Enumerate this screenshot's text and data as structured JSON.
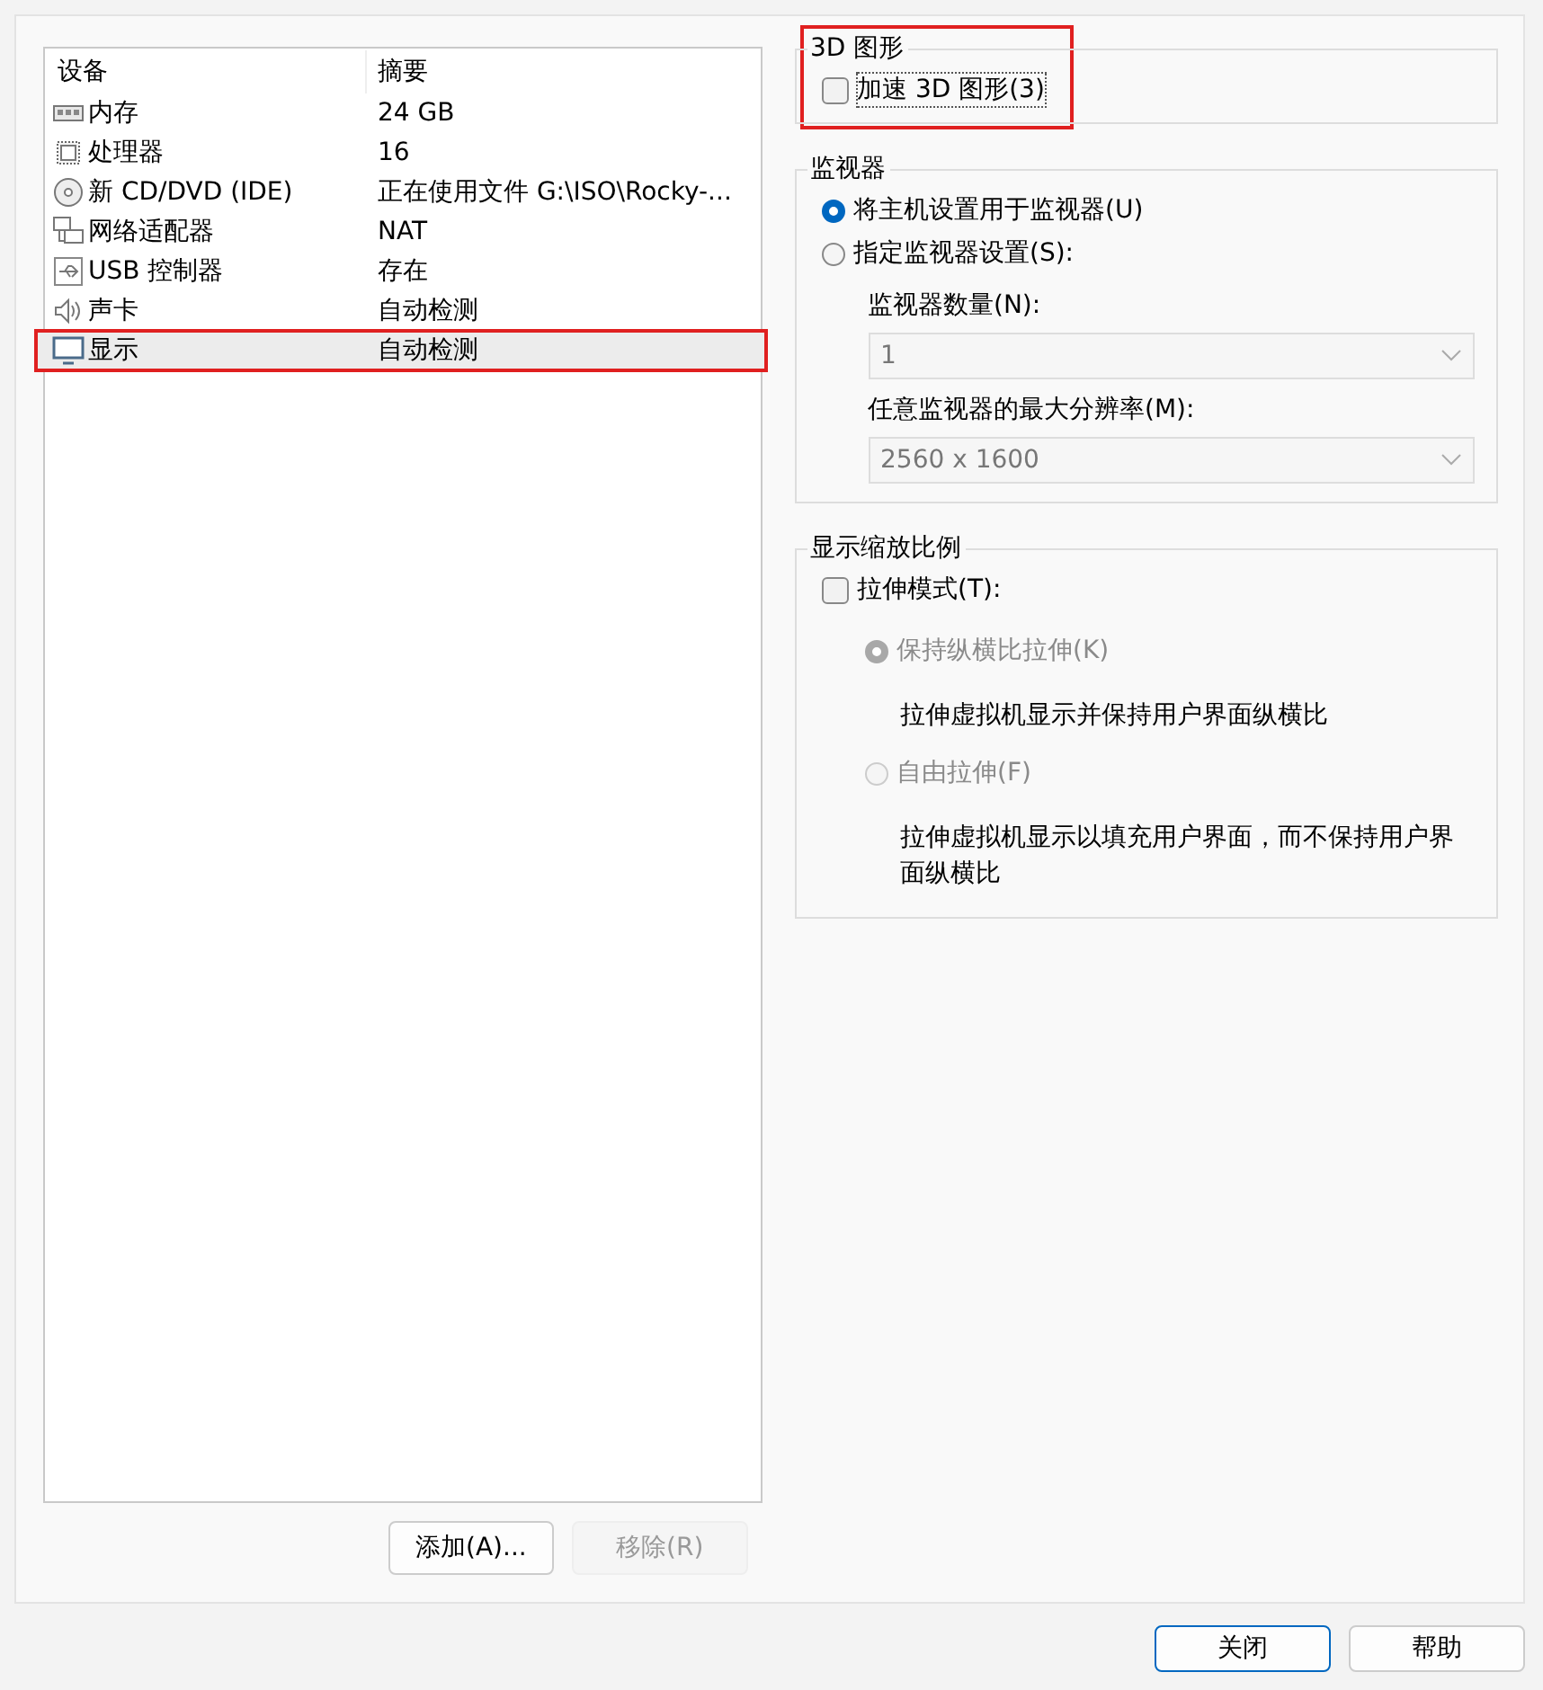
{
  "devices": {
    "columns": [
      "设备",
      "摘要"
    ],
    "rows": [
      {
        "kind": "memory",
        "name": "内存",
        "summary": "24 GB",
        "selected": false,
        "highlighted": false
      },
      {
        "kind": "cpu",
        "name": "处理器",
        "summary": "16",
        "selected": false,
        "highlighted": false
      },
      {
        "kind": "disc",
        "name": "新 CD/DVD (IDE)",
        "summary": "正在使用文件 G:\\ISO\\Rocky-...",
        "selected": false,
        "highlighted": false
      },
      {
        "kind": "network",
        "name": "网络适配器",
        "summary": "NAT",
        "selected": false,
        "highlighted": false
      },
      {
        "kind": "usb",
        "name": "USB 控制器",
        "summary": "存在",
        "selected": false,
        "highlighted": false
      },
      {
        "kind": "sound",
        "name": "声卡",
        "summary": "自动检测",
        "selected": false,
        "highlighted": false
      },
      {
        "kind": "display",
        "name": "显示",
        "summary": "自动检测",
        "selected": true,
        "highlighted": true
      }
    ],
    "buttons": [
      {
        "label": "添加(A)...",
        "disabled": false
      },
      {
        "label": "移除(R)",
        "disabled": true
      }
    ]
  },
  "graphics_3d": {
    "title": "3D 图形",
    "highlighted": true,
    "accelerate": {
      "label": "加速 3D 图形(3)",
      "checked": false
    }
  },
  "monitors": {
    "title": "监视器",
    "options": [
      {
        "label": "将主机设置用于监视器(U)",
        "selected": true
      },
      {
        "label": "指定监视器设置(S):",
        "selected": false
      }
    ],
    "fields": [
      {
        "label": "监视器数量(N):",
        "value": "1",
        "disabled": true
      },
      {
        "label": "任意监视器的最大分辨率(M):",
        "value": "2560 x 1600",
        "disabled": true
      }
    ]
  },
  "scaling": {
    "title": "显示缩放比例",
    "stretch": {
      "label": "拉伸模式(T):",
      "checked": false
    },
    "options": [
      {
        "label": "保持纵横比拉伸(K)",
        "selected": true,
        "disabled": true,
        "description": "拉伸虚拟机显示并保持用户界面纵横比"
      },
      {
        "label": "自由拉伸(F)",
        "selected": false,
        "disabled": true,
        "description": "拉伸虚拟机显示以填充用户界面，而不保持用户界面纵横比"
      }
    ]
  },
  "footer_buttons": [
    {
      "label": "关闭",
      "default": true
    },
    {
      "label": "帮助",
      "default": false
    }
  ]
}
